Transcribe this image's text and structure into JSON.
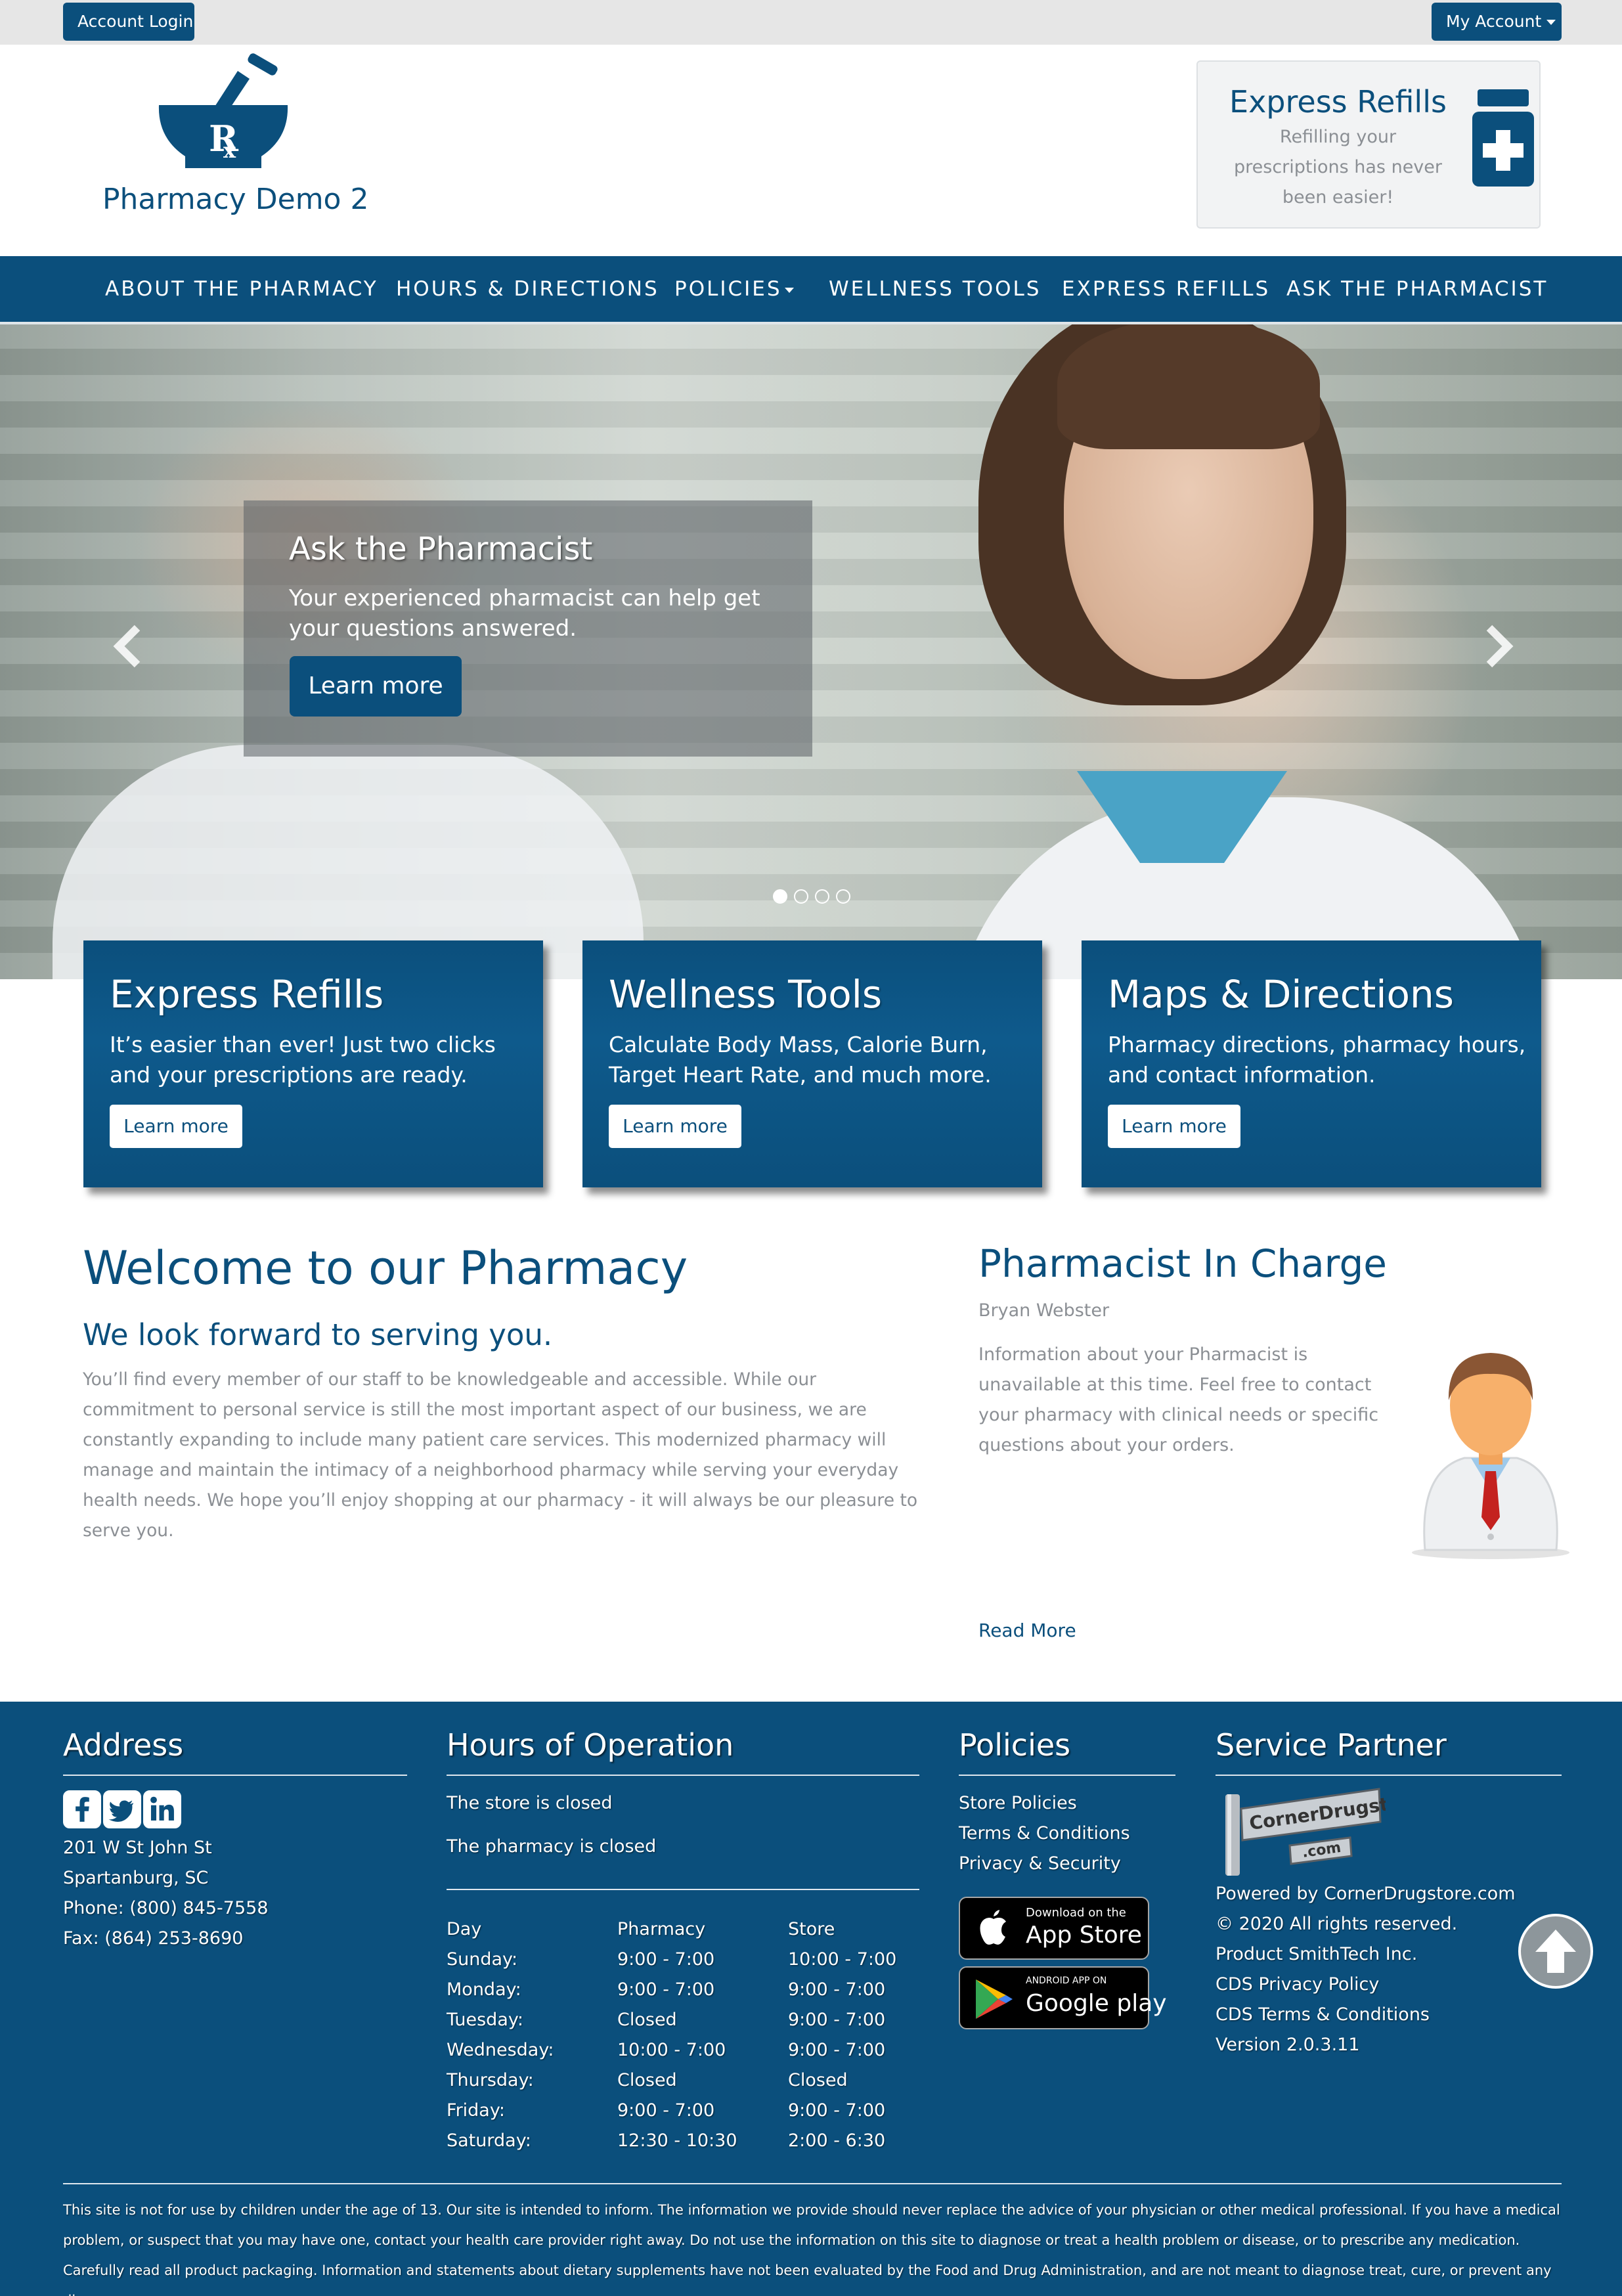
{
  "topbar": {
    "account_login": "Account Login",
    "my_account": "My Account"
  },
  "header": {
    "site_name": "Pharmacy Demo 2",
    "express_box": {
      "title": "Express Refills",
      "subtitle": "Refilling your prescriptions has never been easier!"
    }
  },
  "nav": {
    "items": [
      {
        "label": "ABOUT THE PHARMACY"
      },
      {
        "label": "HOURS & DIRECTIONS"
      },
      {
        "label": "POLICIES"
      },
      {
        "label": "WELLNESS TOOLS"
      },
      {
        "label": "EXPRESS REFILLS"
      },
      {
        "label": "ASK THE PHARMACIST"
      }
    ]
  },
  "hero": {
    "title": "Ask the Pharmacist",
    "text": "Your experienced pharmacist can help get your questions answered.",
    "button": "Learn more",
    "slide_count": 4,
    "active_slide": 1
  },
  "cards": [
    {
      "title": "Express Refills",
      "text": "It’s easier than ever! Just two clicks and your prescriptions are ready.",
      "button": "Learn more"
    },
    {
      "title": "Wellness Tools",
      "text": "Calculate Body Mass, Calorie Burn, Target Heart Rate, and much more.",
      "button": "Learn more"
    },
    {
      "title": "Maps & Directions",
      "text": "Pharmacy directions, pharmacy hours, and contact information.",
      "button": "Learn more"
    }
  ],
  "welcome": {
    "title": "Welcome to our Pharmacy",
    "subtitle": "We look forward to serving you.",
    "text": "You’ll find every member of our staff to be knowledgeable and accessible. While our commitment to personal service is still the most important aspect of our business, we are constantly expanding to include many patient care services. This modernized pharmacy will manage and maintain the intimacy of a neighborhood pharmacy while serving your everyday health needs. We hope you’ll enjoy shopping at our pharmacy - it will always be our pleasure to serve you."
  },
  "pharmacist": {
    "title": "Pharmacist In Charge",
    "name": "Bryan Webster",
    "text": "Information about your Pharmacist is unavailable at this time. Feel free to contact your pharmacy with clinical needs or specific questions about your orders.",
    "read_more": "Read More"
  },
  "footer": {
    "address": {
      "title": "Address",
      "street": "201 W St John St",
      "city": "Spartanburg, SC",
      "phone": "Phone: (800) 845-7558",
      "fax": "Fax: (864) 253-8690"
    },
    "hours": {
      "title": "Hours of Operation",
      "store_status": "The store is closed",
      "pharmacy_status": "The pharmacy is closed",
      "headers": {
        "day": "Day",
        "pharmacy": "Pharmacy",
        "store": "Store"
      },
      "rows": [
        {
          "day": "Sunday:",
          "pharmacy": "9:00 - 7:00",
          "store": "10:00 - 7:00"
        },
        {
          "day": "Monday:",
          "pharmacy": "9:00 - 7:00",
          "store": "9:00 - 7:00"
        },
        {
          "day": "Tuesday:",
          "pharmacy": "Closed",
          "store": "9:00 - 7:00"
        },
        {
          "day": "Wednesday:",
          "pharmacy": "10:00 - 7:00",
          "store": "9:00 - 7:00"
        },
        {
          "day": "Thursday:",
          "pharmacy": "Closed",
          "store": "Closed"
        },
        {
          "day": "Friday:",
          "pharmacy": "9:00 - 7:00",
          "store": "9:00 - 7:00"
        },
        {
          "day": "Saturday:",
          "pharmacy": "12:30 - 10:30",
          "store": "2:00 - 6:30"
        }
      ]
    },
    "policies": {
      "title": "Policies",
      "links": [
        "Store Policies",
        "Terms & Conditions",
        "Privacy & Security"
      ],
      "app_store": {
        "small": "Download on the",
        "big": "App Store"
      },
      "google_play": {
        "small": "ANDROID APP ON",
        "big": "Google play"
      }
    },
    "partner": {
      "title": "Service Partner",
      "logo_text": "CornerDrugstore",
      "logo_sub": ".com",
      "lines": [
        "Powered by CornerDrugstore.com",
        "© 2020 All rights reserved.",
        "Product SmithTech Inc.",
        "CDS Privacy Policy",
        "CDS Terms & Conditions",
        "Version 2.0.3.11"
      ]
    },
    "disclaimer": "This site is not for use by children under the age of 13. Our site is intended to inform. The information we provide should never replace the advice of your physician or other medical professional. If you have a medical problem, or suspect that you may have one, contact your health care provider right away. Do not use the information on this site to diagnose or treat a health problem or disease, or to prescribe any medication. Carefully read all product packaging. Information and statements about dietary supplements have not been evaluated by the Food and Drug Administration, and are not meant to diagnose treat, cure, or prevent any disease."
  },
  "colors": {
    "brand": "#0b4f7c",
    "muted_text": "#8b8f94",
    "topbar_bg": "#e6e6e6"
  },
  "icons": [
    "mortar-pestle-rx-logo",
    "medicine-bottle-icon",
    "chevron-left-icon",
    "chevron-right-icon",
    "facebook-icon",
    "twitter-icon",
    "linkedin-icon",
    "apple-icon",
    "google-play-icon",
    "arrow-up-icon"
  ]
}
